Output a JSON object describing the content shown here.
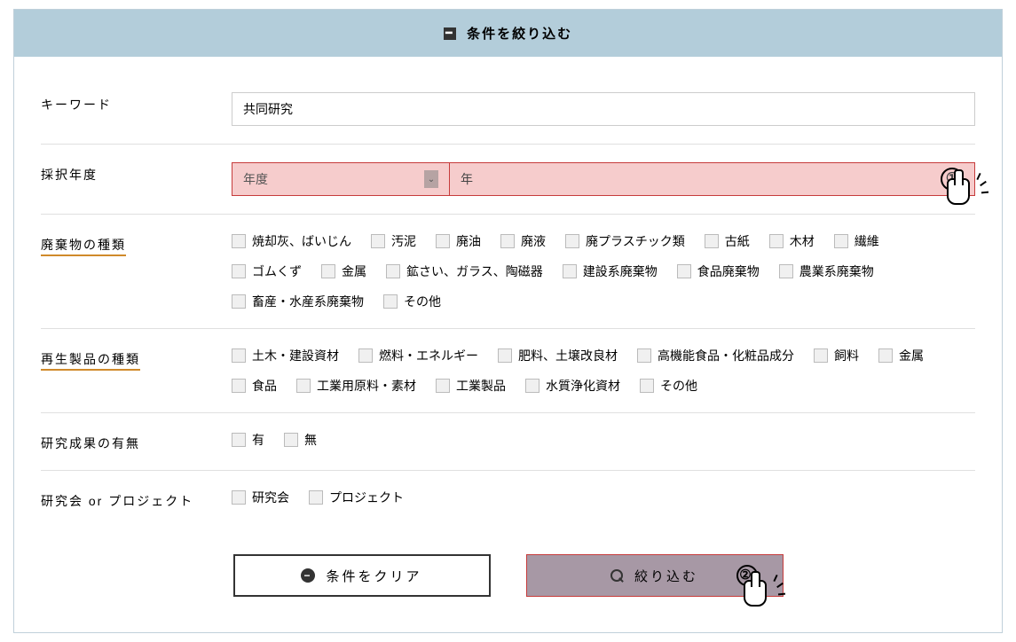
{
  "header": {
    "title": "条件を絞り込む"
  },
  "keyword": {
    "label": "キーワード",
    "value": "共同研究"
  },
  "year": {
    "label": "採択年度",
    "select_placeholder": "年度",
    "suffix": "年",
    "marker": "①"
  },
  "waste": {
    "label": "廃棄物の種類",
    "row1": [
      "焼却灰、ばいじん",
      "汚泥",
      "廃油",
      "廃液",
      "廃プラスチック類",
      "古紙",
      "木材",
      "繊維"
    ],
    "row2": [
      "ゴムくず",
      "金属",
      "鉱さい、ガラス、陶磁器",
      "建設系廃棄物",
      "食品廃棄物",
      "農業系廃棄物"
    ],
    "row3": [
      "畜産・水産系廃棄物",
      "その他"
    ]
  },
  "recycled": {
    "label": "再生製品の種類",
    "row1": [
      "土木・建設資材",
      "燃料・エネルギー",
      "肥料、土壌改良材",
      "高機能食品・化粧品成分",
      "飼料",
      "金属"
    ],
    "row2": [
      "食品",
      "工業用原料・素材",
      "工業製品",
      "水質浄化資材",
      "その他"
    ]
  },
  "results": {
    "label": "研究成果の有無",
    "items": [
      "有",
      "無"
    ]
  },
  "project": {
    "label": "研究会 or プロジェクト",
    "items": [
      "研究会",
      "プロジェクト"
    ]
  },
  "buttons": {
    "clear": "条件をクリア",
    "filter": "絞り込む",
    "filter_marker": "②"
  }
}
